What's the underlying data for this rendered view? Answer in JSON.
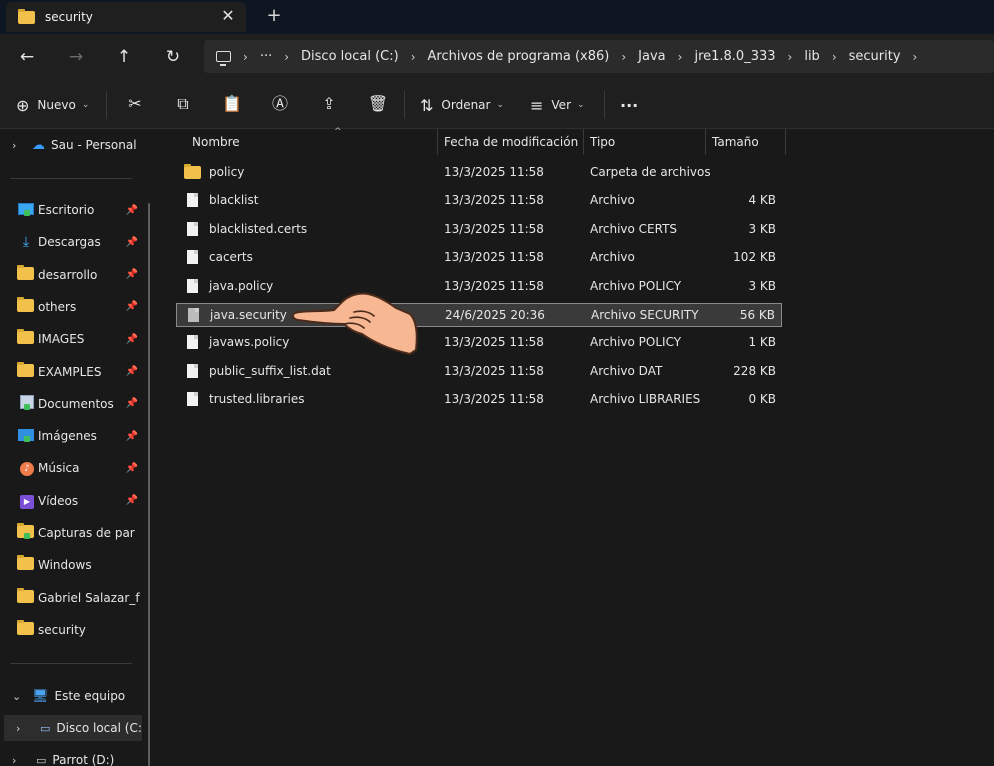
{
  "tab": {
    "title": "security",
    "close": "✕",
    "new": "+"
  },
  "nav": {
    "back": "←",
    "forward": "→",
    "up": "↑",
    "refresh": "↻",
    "more": "···"
  },
  "breadcrumb": [
    "Disco local (C:)",
    "Archivos de programa (x86)",
    "Java",
    "jre1.8.0_333",
    "lib",
    "security"
  ],
  "toolbar": {
    "new_label": "Nuevo",
    "sort_label": "Ordenar",
    "view_label": "Ver",
    "more_label": "···"
  },
  "sidebar": {
    "top": {
      "label": "Sau - Personal"
    },
    "quick": [
      {
        "label": "Escritorio",
        "icon": "desktop-icon",
        "pinned": true
      },
      {
        "label": "Descargas",
        "icon": "download-icon",
        "pinned": true
      },
      {
        "label": "desarrollo",
        "icon": "folder-icon",
        "pinned": true
      },
      {
        "label": "others",
        "icon": "folder-icon",
        "pinned": true
      },
      {
        "label": "IMAGES",
        "icon": "folder-icon",
        "pinned": true
      },
      {
        "label": "EXAMPLES",
        "icon": "folder-icon",
        "pinned": true
      },
      {
        "label": "Documentos",
        "icon": "documents-icon",
        "pinned": true
      },
      {
        "label": "Imágenes",
        "icon": "pictures-icon",
        "pinned": true
      },
      {
        "label": "Música",
        "icon": "music-icon",
        "pinned": true
      },
      {
        "label": "Vídeos",
        "icon": "videos-icon",
        "pinned": true
      },
      {
        "label": "Capturas de par",
        "icon": "folder-icon",
        "pinned": false
      },
      {
        "label": "Windows",
        "icon": "folder-icon",
        "pinned": false
      },
      {
        "label": "Gabriel Salazar_f",
        "icon": "folder-icon",
        "pinned": false
      },
      {
        "label": "security",
        "icon": "folder-icon",
        "pinned": false
      }
    ],
    "this_pc": {
      "label": "Este equipo"
    },
    "drives": [
      {
        "label": "Disco local (C:",
        "selected": true
      },
      {
        "label": "Parrot (D:)",
        "selected": false
      }
    ]
  },
  "columns": {
    "name": "Nombre",
    "date": "Fecha de modificación",
    "type": "Tipo",
    "size": "Tamaño"
  },
  "files": [
    {
      "name": "policy",
      "date": "13/3/2025 11:58",
      "type": "Carpeta de archivos",
      "size": "",
      "kind": "folder"
    },
    {
      "name": "blacklist",
      "date": "13/3/2025 11:58",
      "type": "Archivo",
      "size": "4 KB",
      "kind": "file"
    },
    {
      "name": "blacklisted.certs",
      "date": "13/3/2025 11:58",
      "type": "Archivo CERTS",
      "size": "3 KB",
      "kind": "file"
    },
    {
      "name": "cacerts",
      "date": "13/3/2025 11:58",
      "type": "Archivo",
      "size": "102 KB",
      "kind": "file"
    },
    {
      "name": "java.policy",
      "date": "13/3/2025 11:58",
      "type": "Archivo POLICY",
      "size": "3 KB",
      "kind": "file"
    },
    {
      "name": "java.security",
      "date": "24/6/2025 20:36",
      "type": "Archivo SECURITY",
      "size": "56 KB",
      "kind": "file",
      "selected": true
    },
    {
      "name": "javaws.policy",
      "date": "13/3/2025 11:58",
      "type": "Archivo POLICY",
      "size": "1 KB",
      "kind": "file"
    },
    {
      "name": "public_suffix_list.dat",
      "date": "13/3/2025 11:58",
      "type": "Archivo DAT",
      "size": "228 KB",
      "kind": "file"
    },
    {
      "name": "trusted.libraries",
      "date": "13/3/2025 11:58",
      "type": "Archivo LIBRARIES",
      "size": "0 KB",
      "kind": "file"
    }
  ],
  "colors": {
    "background": "#191919",
    "chrome": "#1f1f1f",
    "folder": "#f2c14b",
    "selection": "#3a3a3a"
  }
}
